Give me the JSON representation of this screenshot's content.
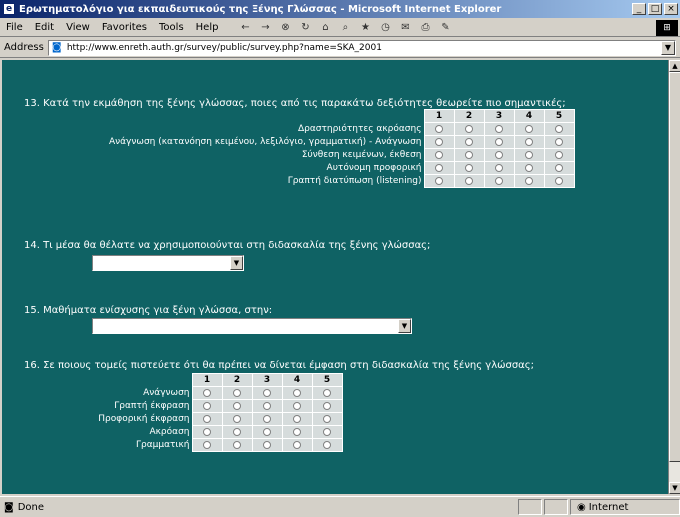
{
  "window": {
    "title": "Ερωτηματολόγιο για εκπαιδευτικούς της Ξένης Γλώσσας - Microsoft Internet Explorer",
    "minimize": "_",
    "maximize": "□",
    "close": "×"
  },
  "menu": [
    "File",
    "Edit",
    "View",
    "Favorites",
    "Tools",
    "Help"
  ],
  "address": {
    "label": "Address",
    "url": "http://www.enreth.auth.gr/survey/public/survey.php?name=SKA_2001"
  },
  "q13": {
    "text": "13. Κατά την εκμάθηση της ξένης γλώσσας, ποιες από τις παρακάτω δεξιότητες θεωρείτε πιο σημαντικές;",
    "columns": [
      "1",
      "2",
      "3",
      "4",
      "5"
    ],
    "rows": [
      "Δραστηριότητες ακρόασης",
      "Ανάγνωση (κατανόηση κειμένου, λεξιλόγιο, γραμματική) - Ανάγνωση",
      "Σύνθεση κειμένων, έκθεση",
      "Αυτόνομη προφορική",
      "Γραπτή διατύπωση (listening)"
    ]
  },
  "q14": {
    "text": "14. Τι μέσα θα θέλατε να χρησιμοποιούνται στη διδασκαλία της ξένης γλώσσας;"
  },
  "q15": {
    "text": "15. Μαθήματα ενίσχυσης για ξένη γλώσσα, στην:"
  },
  "q16": {
    "text": "16. Σε ποιους τομείς πιστεύετε ότι θα πρέπει να δίνεται έμφαση στη διδασκαλία της ξένης γλώσσας;",
    "columns": [
      "1",
      "2",
      "3",
      "4",
      "5"
    ],
    "rows": [
      "Ανάγνωση",
      "Γραπτή έκφραση",
      "Προφορική έκφραση",
      "Ακρόαση",
      "Γραμματική"
    ]
  },
  "status": {
    "text": "Done",
    "zone": "Internet"
  }
}
